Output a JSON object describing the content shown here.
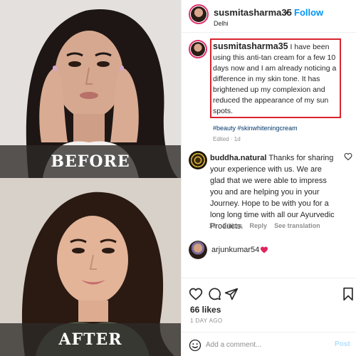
{
  "photos": {
    "before_label": "BEFORE",
    "after_label": "AFTER"
  },
  "header": {
    "username": "susmitasharma35",
    "separator": "•",
    "follow_label": "Follow",
    "location": "Delhi"
  },
  "caption": {
    "username": "susmitasharma35",
    "text": "I have been using this anti-tan cream for a few 10 days now and I am already noticing a difference in my skin tone. It has brightened up my complexion and reduced the appearance of my sun spots.",
    "hashtags": "#beauty #skinwhiteningcream",
    "edited": "Edited · 1d",
    "highlight_color": "#d9242f"
  },
  "comment": {
    "username": "buddha.natural",
    "text": "Thanks for sharing your experience with us. We are glad that we were able to impress you and are helping you in your Journey. Hope to be with you for a long long time with all our Ayurvedic Products.",
    "time": "1d",
    "likes": "2 likes",
    "reply_label": "Reply",
    "translate_label": "See translation"
  },
  "reply": {
    "username": "arjunkumar54",
    "heart": "❤"
  },
  "post": {
    "likes": "66 likes",
    "date": "1 DAY AGO"
  },
  "add_comment": {
    "placeholder": "Add a comment...",
    "post_label": "Post"
  },
  "icons": {
    "like": "heart-icon",
    "comment": "comment-icon",
    "share": "paper-plane-icon",
    "save": "bookmark-icon",
    "emoji": "smile-icon",
    "comment_like": "heart-outline-icon"
  },
  "colors": {
    "link_blue": "#0095f6",
    "hashtag": "#00376b",
    "meta_gray": "#8e8e8e",
    "heart_red": "#e0245e",
    "post_disabled": "#b2dffc"
  }
}
